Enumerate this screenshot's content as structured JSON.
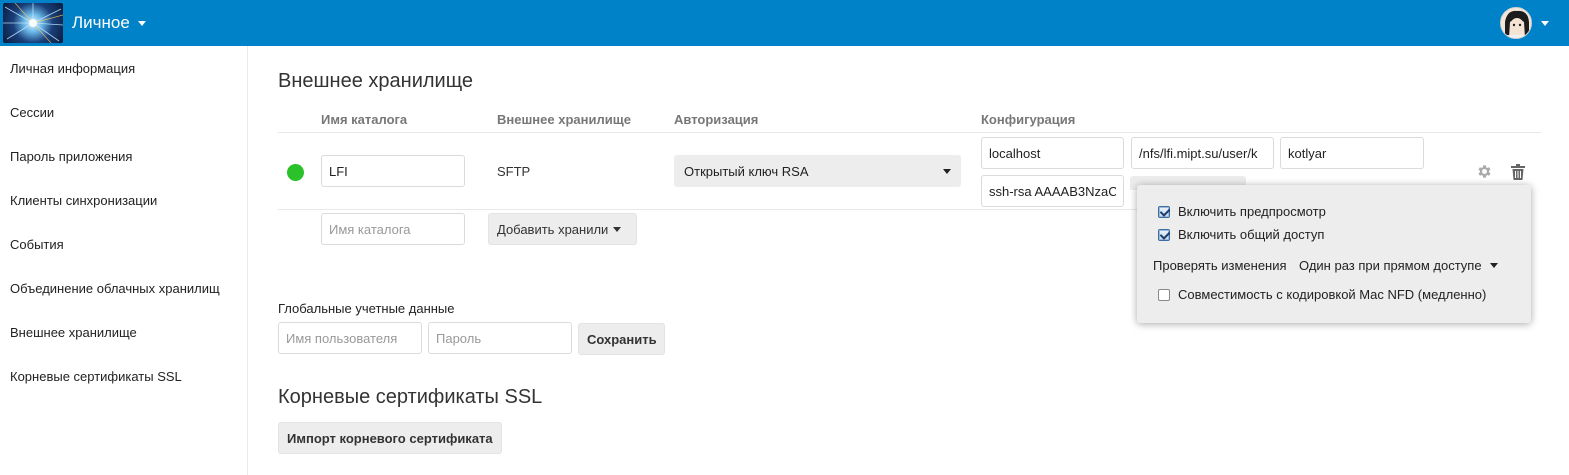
{
  "header": {
    "app_name": "Личное"
  },
  "sidebar": {
    "items": [
      {
        "label": "Личная информация"
      },
      {
        "label": "Сессии"
      },
      {
        "label": "Пароль приложения"
      },
      {
        "label": "Клиенты синхронизации"
      },
      {
        "label": "События"
      },
      {
        "label": "Объединение облачных хранилищ"
      },
      {
        "label": "Внешнее хранилище"
      },
      {
        "label": "Корневые сертификаты SSL"
      }
    ]
  },
  "external_storage": {
    "title": "Внешнее хранилище",
    "columns": {
      "folder": "Имя каталога",
      "storage": "Внешнее хранилище",
      "auth": "Авторизация",
      "config": "Конфигурация"
    },
    "row": {
      "status_color": "#2bc12b",
      "folder_value": "LFI",
      "storage_type": "SFTP",
      "auth_value": "Открытый ключ RSA",
      "config": {
        "host": "localhost",
        "root": "/nfs/lfi.mipt.su/user/k",
        "user": "kotlyar",
        "public_key": "ssh-rsa AAAAB3NzaC"
      }
    },
    "new_row": {
      "folder_placeholder": "Имя каталога",
      "add_button": "Добавить хранили"
    },
    "options": {
      "enable_preview": "Включить предпросмотр",
      "enable_sharing": "Включить общий доступ",
      "check_changes_label": "Проверять изменения",
      "check_changes_value": "Один раз при прямом доступе",
      "mac_nfd": "Совместимость с кодировкой Mac NFD (медленно)"
    }
  },
  "global_credentials": {
    "title": "Глобальные учетные данные",
    "username_placeholder": "Имя пользователя",
    "password_placeholder": "Пароль",
    "save_label": "Сохранить"
  },
  "ssl": {
    "title": "Корневые сертификаты SSL",
    "import_label": "Импорт корневого сертификата"
  },
  "colors": {
    "header": "#0082c9",
    "status_ok": "#2bc12b"
  }
}
